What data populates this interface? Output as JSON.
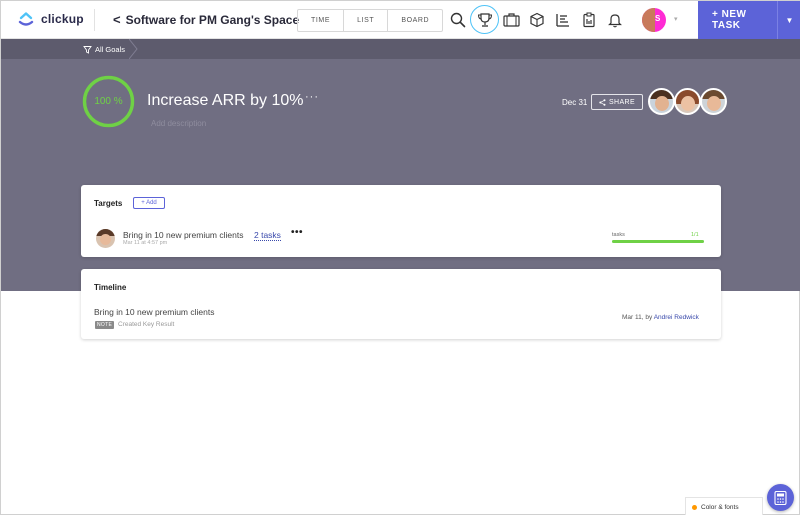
{
  "app": {
    "logo_text": "clickup"
  },
  "header": {
    "back_chevron": "<",
    "space_title": "Software for PM Gang's Space",
    "view_tabs": [
      {
        "label": "TIME"
      },
      {
        "label": "LIST"
      },
      {
        "label": "BOARD"
      }
    ],
    "user_initial": "S",
    "user_caret": "▾",
    "new_task_label": "+ NEW TASK",
    "new_task_dropdown": "▼"
  },
  "breadcrumb": {
    "label": "All Goals"
  },
  "goal": {
    "progress_text": "100 %",
    "progress_fraction": 1.0,
    "title": "Increase ARR by 10%",
    "more": "···",
    "description_placeholder": "Add description",
    "due_date": "Dec 31",
    "share_label": "SHARE"
  },
  "targets": {
    "title": "Targets",
    "add_label": "+ Add",
    "items": [
      {
        "name": "Bring in 10 new premium clients",
        "tasks_link": "2 tasks",
        "more": "•••",
        "created": "Mar 11 at 4:57 pm",
        "bar_label": "tasks",
        "bar_count": "1/1",
        "progress_fraction": 1.0
      }
    ]
  },
  "timeline": {
    "title": "Timeline",
    "entries": [
      {
        "name": "Bring in 10 new premium clients",
        "tag": "NOTE",
        "action": "Created Key Result",
        "date_prefix": "Mar 11, by",
        "author": "Andrei Redwick"
      }
    ]
  },
  "footer": {
    "color_fonts_label": "Color & fonts"
  },
  "colors": {
    "accent": "#5c63d8",
    "hero_bg": "#706e82",
    "progress_green": "#6fd146",
    "link_blue": "#3949ab"
  },
  "icons": [
    "search-icon",
    "trophy-icon",
    "briefcase-icon",
    "box-icon",
    "list-chart-icon",
    "clipboard-icon",
    "bell-icon",
    "calculator-icon",
    "share-icon",
    "funnel-icon"
  ]
}
